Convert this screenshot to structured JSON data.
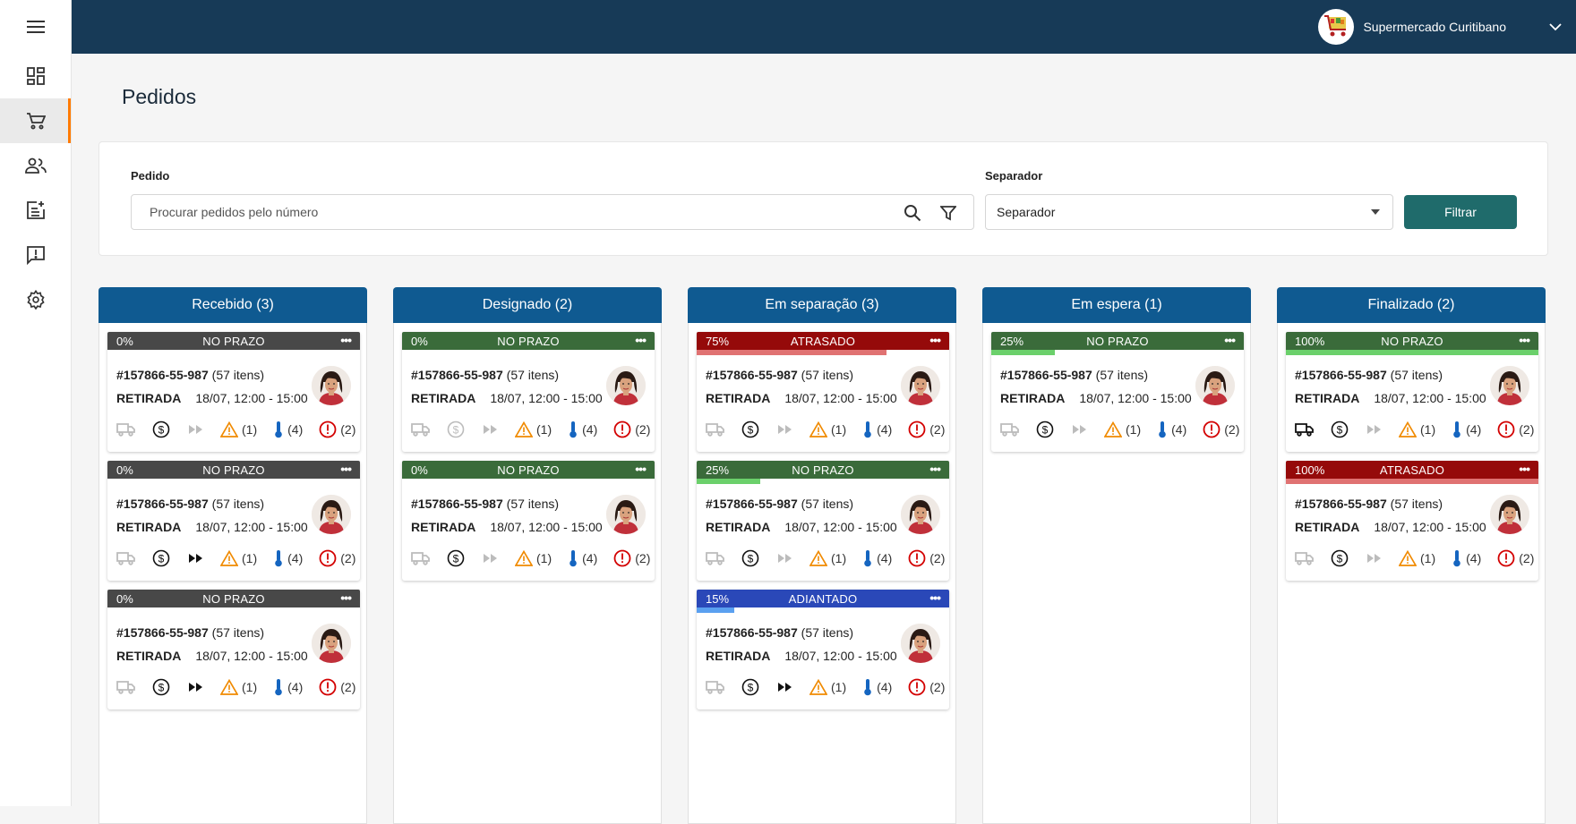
{
  "app": {
    "store_name": "Supermercado Curitibano"
  },
  "sidebar": {
    "items": [
      "menu-icon",
      "dashboard-icon",
      "cart-icon",
      "people-icon",
      "add-note-icon",
      "feedback-icon",
      "gear-icon"
    ],
    "active": "cart-icon"
  },
  "page": {
    "title": "Pedidos"
  },
  "filter": {
    "order_label": "Pedido",
    "search_placeholder": "Procurar pedidos pelo número",
    "separator_label": "Separador",
    "separator_value": "Separador",
    "button_label": "Filtrar"
  },
  "colors": {
    "topbar": "#173a57",
    "column_header": "#0f5a91",
    "accent": "#ff7a00",
    "filter_button": "#1f6b6b",
    "status_no_prazo_grey": "#484848",
    "status_no_prazo_green": "#3a6b3a",
    "status_atrasado": "#950a0a",
    "status_adiantado": "#2a48b8"
  },
  "columns": [
    {
      "title": "Recebido (3)",
      "cards": [
        {
          "pct": "0%",
          "status": "NO PRAZO",
          "bar": "#484848",
          "progress": 0,
          "prog_color": "#6bd06b",
          "order": "#157866-55-987",
          "items": " (57 itens)",
          "type": "RETIRADA",
          "time": "18/07, 12:00 - 15:00",
          "truck": false,
          "money": true,
          "fast": false,
          "warn": "(1)",
          "temp": "(4)",
          "alert": "(2)"
        },
        {
          "pct": "0%",
          "status": "NO PRAZO",
          "bar": "#484848",
          "progress": 0,
          "prog_color": "#6bd06b",
          "order": "#157866-55-987",
          "items": " (57 itens)",
          "type": "RETIRADA",
          "time": "18/07, 12:00 - 15:00",
          "truck": false,
          "money": true,
          "fast": true,
          "warn": "(1)",
          "temp": "(4)",
          "alert": "(2)"
        },
        {
          "pct": "0%",
          "status": "NO PRAZO",
          "bar": "#484848",
          "progress": 0,
          "prog_color": "#6bd06b",
          "order": "#157866-55-987",
          "items": " (57 itens)",
          "type": "RETIRADA",
          "time": "18/07, 12:00 - 15:00",
          "truck": false,
          "money": true,
          "fast": true,
          "warn": "(1)",
          "temp": "(4)",
          "alert": "(2)"
        }
      ]
    },
    {
      "title": "Designado (2)",
      "cards": [
        {
          "pct": "0%",
          "status": "NO PRAZO",
          "bar": "#3a6b3a",
          "progress": 0,
          "prog_color": "#6bd06b",
          "order": "#157866-55-987",
          "items": " (57 itens)",
          "type": "RETIRADA",
          "time": "18/07, 12:00 - 15:00",
          "truck": false,
          "money": false,
          "fast": false,
          "warn": "(1)",
          "temp": "(4)",
          "alert": "(2)"
        },
        {
          "pct": "0%",
          "status": "NO PRAZO",
          "bar": "#3a6b3a",
          "progress": 0,
          "prog_color": "#6bd06b",
          "order": "#157866-55-987",
          "items": " (57 itens)",
          "type": "RETIRADA",
          "time": "18/07, 12:00 - 15:00",
          "truck": false,
          "money": true,
          "fast": false,
          "warn": "(1)",
          "temp": "(4)",
          "alert": "(2)"
        }
      ]
    },
    {
      "title": "Em separação (3)",
      "cards": [
        {
          "pct": "75%",
          "status": "ATRASADO",
          "bar": "#950a0a",
          "progress": 0.75,
          "prog_color": "#e07272",
          "order": "#157866-55-987",
          "items": " (57 itens)",
          "type": "RETIRADA",
          "time": "18/07, 12:00 - 15:00",
          "truck": false,
          "money": true,
          "fast": false,
          "warn": "(1)",
          "temp": "(4)",
          "alert": "(2)"
        },
        {
          "pct": "25%",
          "status": "NO PRAZO",
          "bar": "#3a6b3a",
          "progress": 0.25,
          "prog_color": "#6bd06b",
          "order": "#157866-55-987",
          "items": " (57 itens)",
          "type": "RETIRADA",
          "time": "18/07, 12:00 - 15:00",
          "truck": false,
          "money": true,
          "fast": false,
          "warn": "(1)",
          "temp": "(4)",
          "alert": "(2)"
        },
        {
          "pct": "15%",
          "status": "ADIANTADO",
          "bar": "#2a48b8",
          "progress": 0.15,
          "prog_color": "#5aa0f0",
          "order": "#157866-55-987",
          "items": " (57 itens)",
          "type": "RETIRADA",
          "time": "18/07, 12:00 - 15:00",
          "truck": false,
          "money": true,
          "fast": true,
          "warn": "(1)",
          "temp": "(4)",
          "alert": "(2)"
        }
      ]
    },
    {
      "title": "Em espera (1)",
      "cards": [
        {
          "pct": "25%",
          "status": "NO PRAZO",
          "bar": "#3a6b3a",
          "progress": 0.25,
          "prog_color": "#6bd06b",
          "order": "#157866-55-987",
          "items": " (57 itens)",
          "type": "RETIRADA",
          "time": "18/07, 12:00 - 15:00",
          "truck": false,
          "money": true,
          "fast": false,
          "warn": "(1)",
          "temp": "(4)",
          "alert": "(2)"
        }
      ]
    },
    {
      "title": "Finalizado (2)",
      "cards": [
        {
          "pct": "100%",
          "status": "NO PRAZO",
          "bar": "#3a6b3a",
          "progress": 1,
          "prog_color": "#6bd06b",
          "order": "#157866-55-987",
          "items": " (57 itens)",
          "type": "RETIRADA",
          "time": "18/07, 12:00 - 15:00",
          "truck": true,
          "money": true,
          "fast": false,
          "warn": "(1)",
          "temp": "(4)",
          "alert": "(2)"
        },
        {
          "pct": "100%",
          "status": "ATRASADO",
          "bar": "#950a0a",
          "progress": 1,
          "prog_color": "#e07272",
          "order": "#157866-55-987",
          "items": " (57 itens)",
          "type": "RETIRADA",
          "time": "18/07, 12:00 - 15:00",
          "truck": false,
          "money": true,
          "fast": false,
          "warn": "(1)",
          "temp": "(4)",
          "alert": "(2)"
        }
      ]
    }
  ]
}
